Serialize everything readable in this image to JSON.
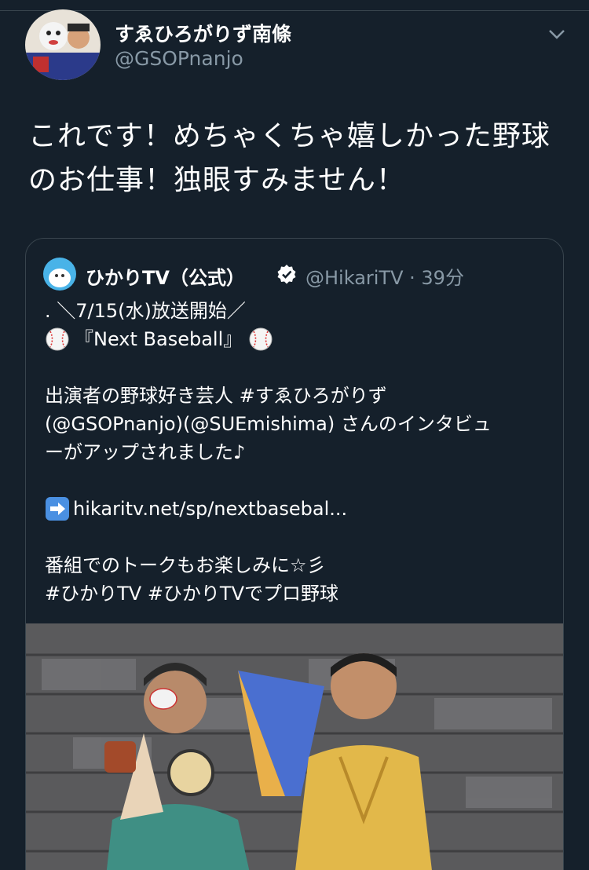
{
  "tweet": {
    "author_name": "すゑひろがりず南條",
    "author_handle": "@GSOPnanjo",
    "text": "これです！めちゃくちゃ嬉しかった野球のお仕事！独眼すみません！"
  },
  "quote": {
    "author_name": "ひかりTV（公式）",
    "author_handle": "@HikariTV",
    "time": "· 39分",
    "lines": {
      "l1": ". ＼7/15(水)放送開始／",
      "l2": "『Next Baseball』",
      "l3": "出演者の野球好き芸人 #すゑひろがりず",
      "l4": "(@GSOPnanjo)(@SUEmishima) さんのインタビュ",
      "l5": "ーがアップされました♪",
      "l6": "hikaritv.net/sp/nextbasebal...",
      "l7": "番組でのトークもお楽しみに☆彡",
      "l8": "#ひかりTV #ひかりTVでプロ野球"
    }
  },
  "colors": {
    "background": "#15202b",
    "secondary_text": "#8899a6",
    "border": "#38444d",
    "verified": "#ffffff"
  },
  "icons": [
    "chevron-down-icon",
    "verified-badge-icon",
    "baseball-emoji-icon",
    "right-arrow-emoji-icon"
  ]
}
